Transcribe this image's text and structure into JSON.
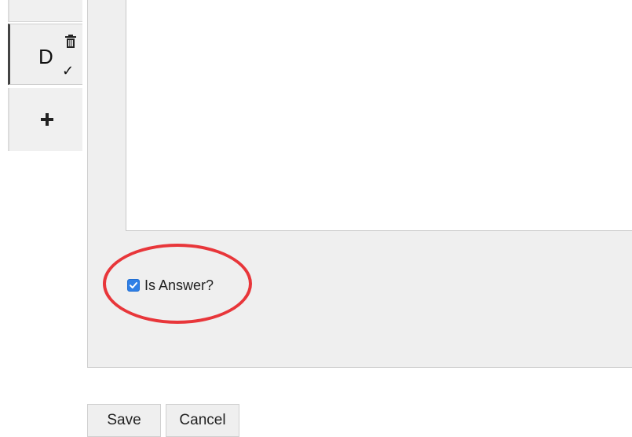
{
  "tabs": [
    {
      "label": ""
    },
    {
      "label": "D",
      "is_answer": true,
      "selected": true
    },
    {
      "label": ""
    }
  ],
  "answer": {
    "label": "Is Answer?",
    "checked": true
  },
  "buttons": {
    "save_label": "Save",
    "cancel_label": "Cancel"
  },
  "icons": {
    "delete": "trash-icon",
    "answer_mark": "check-icon",
    "add": "plus-icon"
  },
  "colors": {
    "highlight": "#e8363a",
    "checkbox": "#2f7fe6"
  }
}
